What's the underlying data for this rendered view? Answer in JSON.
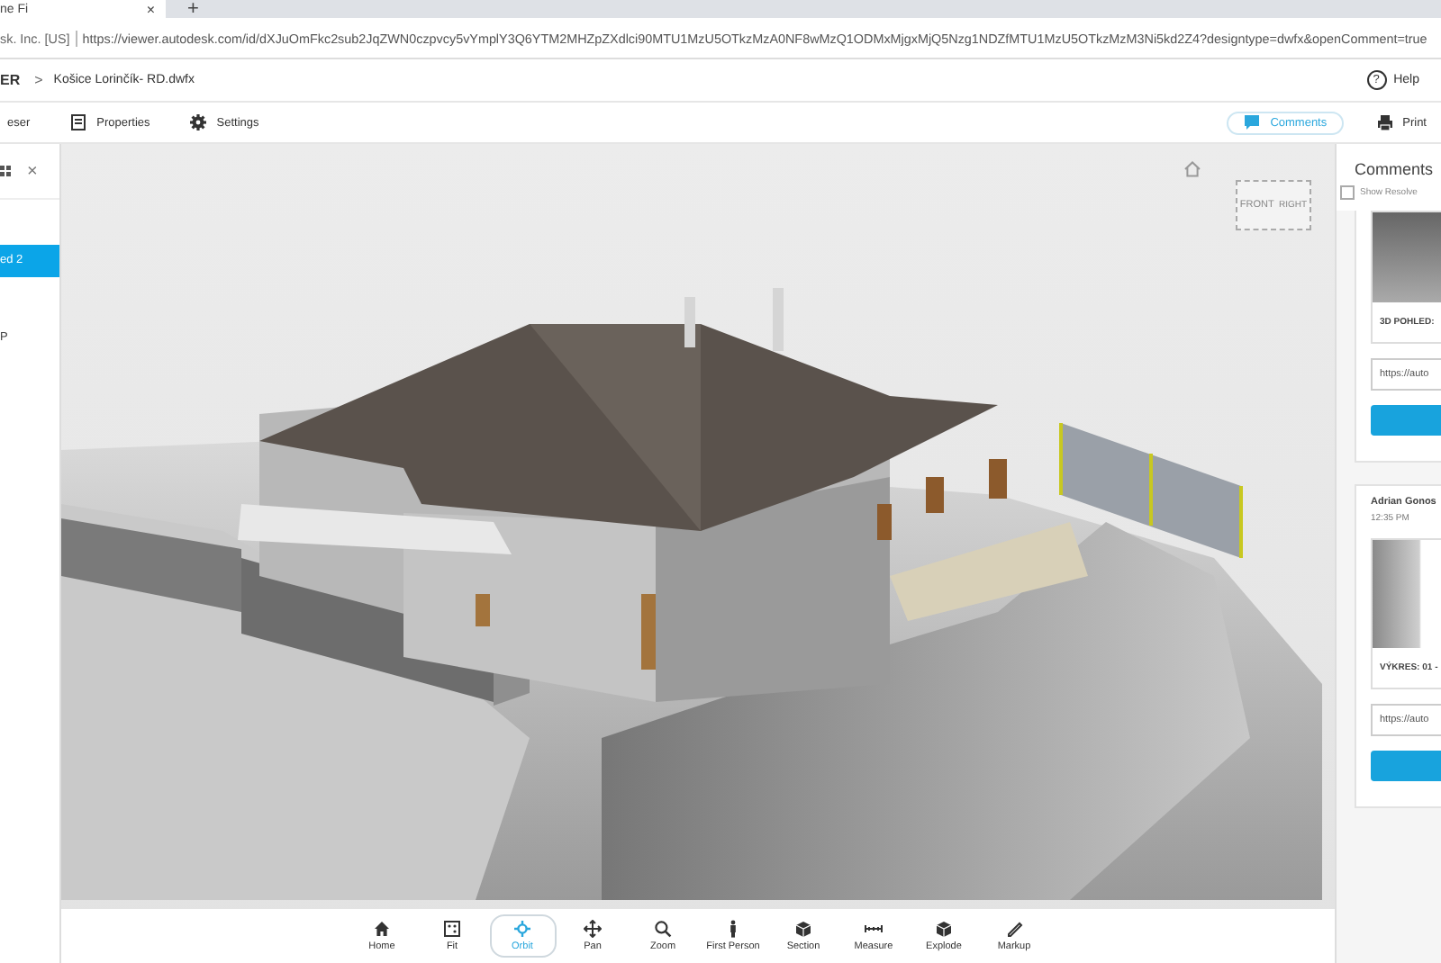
{
  "browser": {
    "tab": {
      "title": "ne Fi",
      "close": "×"
    },
    "new_tab": "+",
    "site_identity": "sk. Inc. [US]",
    "url": "https://viewer.autodesk.com/id/dXJuOmFkc2sub2JqZWN0czpvcy5vYmplY3Q6YTM2MHZpZXdlci90MTU1MzU5OTkzMzA0NF8wMzQ1ODMxMjgxMjQ5Nzg1NDZfMTU1MzU5OTkzMzM3Ni5kd2Z4?designtype=dwfx&openComment=true"
  },
  "header": {
    "app": "ER",
    "separator": ">",
    "file": "Košice Lorinčík- RD.dwfx",
    "help_icon": "?",
    "help": "Help"
  },
  "toolbar": {
    "left": [
      {
        "label": "eser"
      },
      {
        "label": "Properties"
      },
      {
        "label": "Settings"
      }
    ],
    "right": [
      {
        "label": "Comments",
        "selected": true
      },
      {
        "label": "Print",
        "selected": false
      }
    ]
  },
  "side_panel": {
    "close": "×",
    "items": [
      {
        "label": "ed 2",
        "selected": true
      },
      {
        "label": "P",
        "selected": false
      }
    ]
  },
  "viewcube": {
    "faces": [
      "FRONT",
      "RIGHT"
    ]
  },
  "nav_tools": [
    {
      "label": "Home",
      "selected": false
    },
    {
      "label": "Fit",
      "selected": false
    },
    {
      "label": "Orbit",
      "selected": true
    },
    {
      "label": "Pan",
      "selected": false
    },
    {
      "label": "Zoom",
      "selected": false
    },
    {
      "label": "First Person",
      "selected": false
    },
    {
      "label": "Section",
      "selected": false
    },
    {
      "label": "Measure",
      "selected": false
    },
    {
      "label": "Explode",
      "selected": false
    },
    {
      "label": "Markup",
      "selected": false
    }
  ],
  "comments": {
    "title": "Comments",
    "show_resolved": {
      "label": "Show Resolve",
      "checked": false
    },
    "cards": [
      {
        "caption": "3D POHLED:",
        "link": "https://auto"
      },
      {
        "author": "Adrian Gonos",
        "time": "12:35 PM",
        "caption": "VÝKRES: 01 -",
        "link": "https://auto"
      }
    ]
  }
}
